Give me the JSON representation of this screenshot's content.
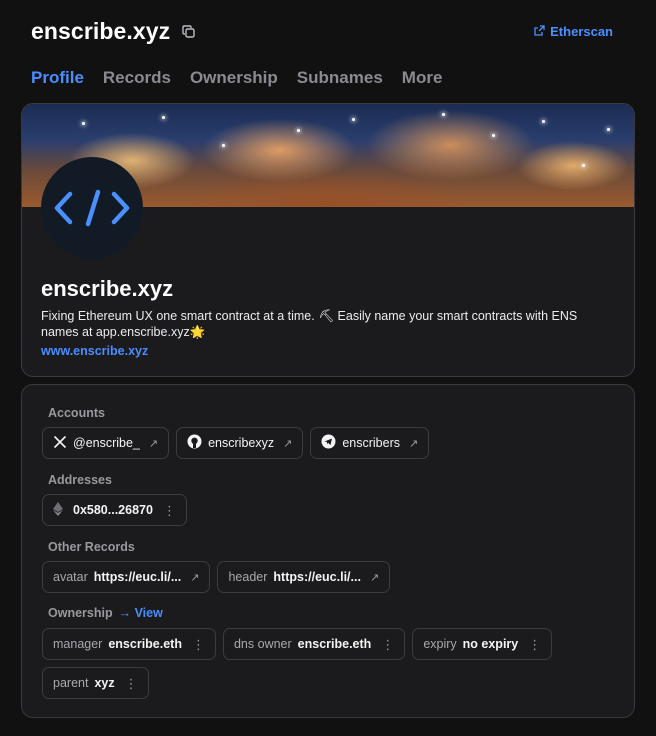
{
  "header": {
    "title": "enscribe.xyz",
    "etherscan_label": "Etherscan"
  },
  "tabs": [
    {
      "label": "Profile",
      "active": true
    },
    {
      "label": "Records"
    },
    {
      "label": "Ownership"
    },
    {
      "label": "Subnames"
    },
    {
      "label": "More"
    }
  ],
  "profile": {
    "name": "enscribe.xyz",
    "bio_line1": "Fixing Ethereum UX one smart contract at a time. ⛏  Easily name your smart contracts with ENS",
    "bio_line2": "names at app.enscribe.xyz🌟",
    "website": "www.enscribe.xyz"
  },
  "records": {
    "accounts_label": "Accounts",
    "accounts": [
      {
        "icon": "x-icon",
        "label": "@enscribe_"
      },
      {
        "icon": "github-icon",
        "label": "enscribexyz"
      },
      {
        "icon": "telegram-icon",
        "label": "enscribers"
      }
    ],
    "addresses_label": "Addresses",
    "address": "0x580...26870",
    "other_records_label": "Other Records",
    "other_records": [
      {
        "key": "avatar",
        "value": "https://euc.li/..."
      },
      {
        "key": "header",
        "value": "https://euc.li/..."
      }
    ],
    "ownership_label": "Ownership",
    "ownership_view": "→ View",
    "ownership": [
      {
        "key": "manager",
        "value": "enscribe.eth"
      },
      {
        "key": "dns owner",
        "value": "enscribe.eth"
      },
      {
        "key": "expiry",
        "value": "no expiry"
      }
    ],
    "parent": {
      "key": "parent",
      "value": "xyz"
    }
  },
  "colors": {
    "accent": "#4a8dff",
    "background": "#111112",
    "card": "#1b1b1d"
  }
}
